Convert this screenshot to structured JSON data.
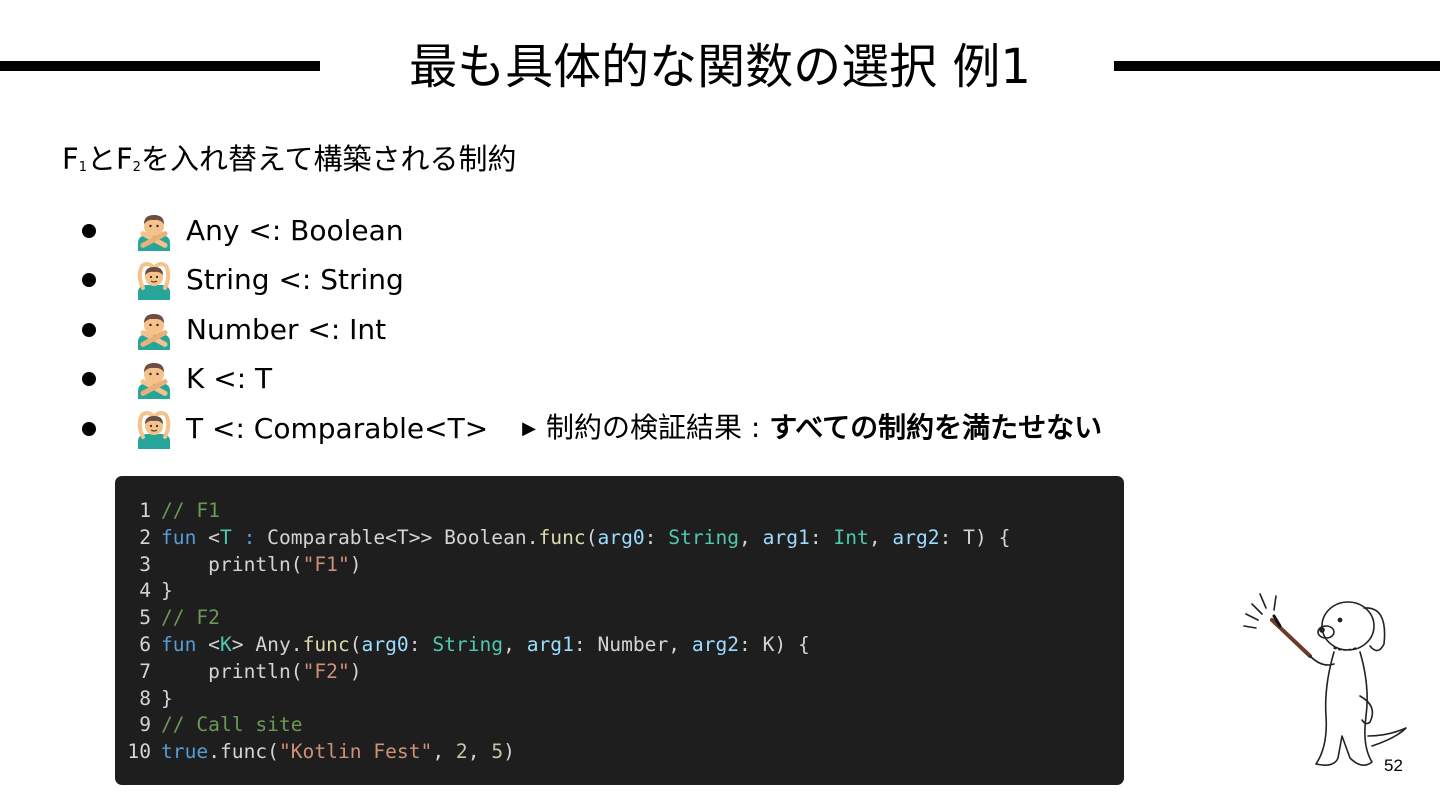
{
  "slide": {
    "title": "最も具体的な関数の選択 例1",
    "subtitle": {
      "p1": "F",
      "s1": "1",
      "p2": "とF",
      "s2": "2",
      "p3": "を入れ替えて構築される制約"
    },
    "page_number": "52"
  },
  "bullets": [
    {
      "gesture": "no-good-gesture-icon",
      "text": "Any <: Boolean"
    },
    {
      "gesture": "ok-gesture-icon",
      "text": "String <: String"
    },
    {
      "gesture": "no-good-gesture-icon",
      "text": "Number <: Int"
    },
    {
      "gesture": "no-good-gesture-icon",
      "text": "K <: T"
    },
    {
      "gesture": "ok-gesture-icon",
      "text": "T <: Comparable<T>"
    }
  ],
  "result": {
    "arrow": "▶",
    "label": "制約の検証結果 : ",
    "emphasis": "すべての制約を満たせない"
  },
  "code": {
    "lines": [
      {
        "n": "1",
        "tokens": [
          [
            "c-com",
            "// F1"
          ]
        ]
      },
      {
        "n": "2",
        "tokens": [
          [
            "c-kw",
            "fun"
          ],
          [
            "",
            " <"
          ],
          [
            "c-type",
            "T"
          ],
          [
            "c-kw",
            " : "
          ],
          [
            "",
            "Comparable<T>> Boolean."
          ],
          [
            "c-fn",
            "func"
          ],
          [
            "",
            "("
          ],
          [
            "c-par",
            "arg0"
          ],
          [
            "",
            ": "
          ],
          [
            "c-type",
            "String"
          ],
          [
            "",
            ", "
          ],
          [
            "c-par",
            "arg1"
          ],
          [
            "",
            ": "
          ],
          [
            "c-type",
            "Int"
          ],
          [
            "",
            ", "
          ],
          [
            "c-par",
            "arg2"
          ],
          [
            "",
            ": T) {"
          ]
        ]
      },
      {
        "n": "3",
        "tokens": [
          [
            "",
            "    println("
          ],
          [
            "c-str",
            "\"F1\""
          ],
          [
            "",
            ")"
          ]
        ]
      },
      {
        "n": "4",
        "tokens": [
          [
            "",
            "}"
          ]
        ]
      },
      {
        "n": "5",
        "tokens": [
          [
            "c-com",
            "// F2"
          ]
        ]
      },
      {
        "n": "6",
        "tokens": [
          [
            "c-kw",
            "fun"
          ],
          [
            "",
            " <"
          ],
          [
            "c-type",
            "K"
          ],
          [
            "",
            "> Any."
          ],
          [
            "c-fn",
            "func"
          ],
          [
            "",
            "("
          ],
          [
            "c-par",
            "arg0"
          ],
          [
            "",
            ": "
          ],
          [
            "c-type",
            "String"
          ],
          [
            "",
            ", "
          ],
          [
            "c-par",
            "arg1"
          ],
          [
            "",
            ": Number, "
          ],
          [
            "c-par",
            "arg2"
          ],
          [
            "",
            ": K) {"
          ]
        ]
      },
      {
        "n": "7",
        "tokens": [
          [
            "",
            "    println("
          ],
          [
            "c-str",
            "\"F2\""
          ],
          [
            "",
            ")"
          ]
        ]
      },
      {
        "n": "8",
        "tokens": [
          [
            "",
            "}"
          ]
        ]
      },
      {
        "n": "9",
        "tokens": [
          [
            "c-com",
            "// Call site"
          ]
        ]
      },
      {
        "n": "10",
        "tokens": [
          [
            "c-kw",
            "true"
          ],
          [
            "",
            "."
          ],
          [
            "",
            "func("
          ],
          [
            "c-str",
            "\"Kotlin Fest\""
          ],
          [
            "",
            ", "
          ],
          [
            "c-num",
            "2"
          ],
          [
            "",
            ", "
          ],
          [
            "c-num",
            "5"
          ],
          [
            "",
            ")"
          ]
        ]
      }
    ]
  },
  "colors": {
    "code_background": "#1e1e1e",
    "comment": "#6a9955",
    "keyword": "#569cd6",
    "function": "#dcdcaa",
    "parameter": "#9cdcfe",
    "type": "#4ec9b0",
    "string": "#ce9178",
    "number": "#b5cea8",
    "gesture_shirt": "#26a69a",
    "gesture_skin": "#f4c28a",
    "gesture_hair": "#6d4c41"
  }
}
